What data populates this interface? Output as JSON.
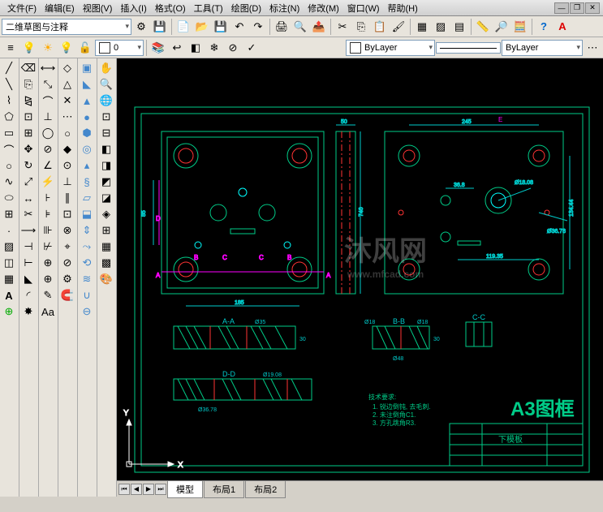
{
  "menu": {
    "file": "文件(F)",
    "edit": "编辑(E)",
    "view": "视图(V)",
    "insert": "插入(I)",
    "format": "格式(O)",
    "tools": "工具(T)",
    "draw": "绘图(D)",
    "dimension": "标注(N)",
    "modify": "修改(M)",
    "window": "窗口(W)",
    "help": "帮助(H)"
  },
  "workspace": "二维草图与注释",
  "layer_val": "0",
  "color": "ByLayer",
  "linetype": "ByLayer",
  "tabs": {
    "model": "模型",
    "layout1": "布局1",
    "layout2": "布局2"
  },
  "drawing": {
    "frame_title": "A3图框",
    "tech_label": "技术要求:",
    "tech1": "1. 锐边倒钝, 去毛刺.",
    "tech2": "2. 未注倒角C1.",
    "tech3": "3. 方孔跳角R3.",
    "title_block_name": "下模板",
    "dims": {
      "d1": "50",
      "d2": "245",
      "d3": "36.8",
      "d4": "Ø18.08",
      "d5": "Ø36.78",
      "d6": "119.35",
      "d7": "134.44",
      "d8": "746",
      "d9": "185",
      "d10": "85",
      "d11": "Ø35",
      "d12": "30",
      "d13": "30",
      "d14": "Ø48",
      "d15": "Ø19.08",
      "d16": "Ø36.78",
      "d17": "Ø18",
      "d18": "Ø18"
    },
    "sections": {
      "aa": "A-A",
      "bb": "B-B",
      "cc": "C-C",
      "dd": "D-D"
    },
    "markers": {
      "a": "A",
      "b": "B",
      "c": "C",
      "d": "D",
      "e": "E"
    },
    "axes": {
      "x": "X",
      "y": "Y"
    }
  },
  "watermark": {
    "text": "沐风网",
    "url": "www.mfcad.com"
  }
}
